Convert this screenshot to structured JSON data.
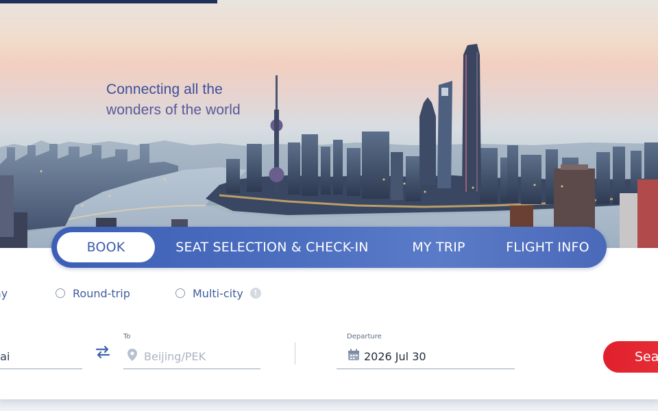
{
  "hero": {
    "tagline_line1": "Connecting all the",
    "tagline_line2": "wonders of the world"
  },
  "tabs": [
    {
      "label": "BOOK",
      "active": true
    },
    {
      "label": "SEAT SELECTION & CHECK-IN",
      "active": false
    },
    {
      "label": "MY TRIP",
      "active": false
    },
    {
      "label": "FLIGHT INFO",
      "active": false
    }
  ],
  "trip_type": {
    "options": [
      {
        "label": "ay",
        "icon": "radio-icon",
        "checked": false
      },
      {
        "label": "Round-trip",
        "icon": "radio-icon",
        "checked": false
      },
      {
        "label": "Multi-city",
        "icon": "radio-icon",
        "checked": false
      }
    ],
    "info_icon": "info-icon",
    "info_glyph": "!"
  },
  "search": {
    "from": {
      "value": "hai"
    },
    "to": {
      "label": "To",
      "placeholder": "Beijing/PEK",
      "icon": "location-pin-icon"
    },
    "swap_icon": "swap-arrows-icon",
    "departure": {
      "label": "Departure",
      "value": "2026 Jul 30",
      "icon": "calendar-icon"
    },
    "button_label": "Sea"
  },
  "colors": {
    "accent_blue": "#3f5fb3",
    "tab_text_active": "#3a5ea8",
    "search_red": "#e0202c",
    "navy": "#1f2f5a"
  }
}
